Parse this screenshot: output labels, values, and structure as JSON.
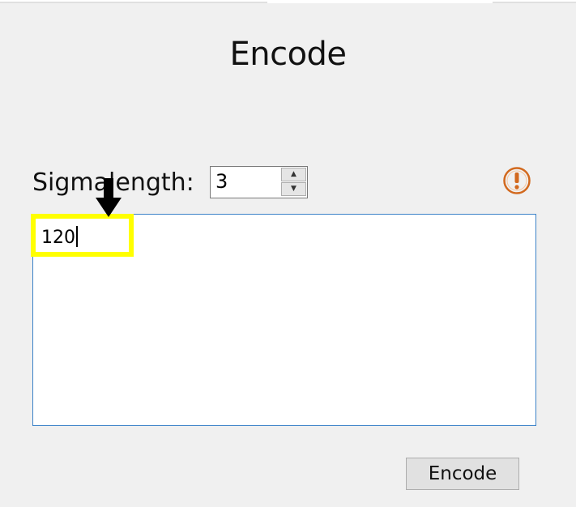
{
  "window": {
    "title": "Encode"
  },
  "form": {
    "sigma_label": "Sigmalength:",
    "sigma_value": "3",
    "spin_up_glyph": "▲",
    "spin_down_glyph": "▼",
    "warning_icon": "exclamation-circle-icon",
    "input_text": "120"
  },
  "actions": {
    "encode_label": "Encode"
  },
  "colors": {
    "background": "#f0f0f0",
    "textarea_border": "#3c82c8",
    "warning": "#d2691e",
    "highlight": "#ffff00",
    "arrow": "#000000"
  }
}
